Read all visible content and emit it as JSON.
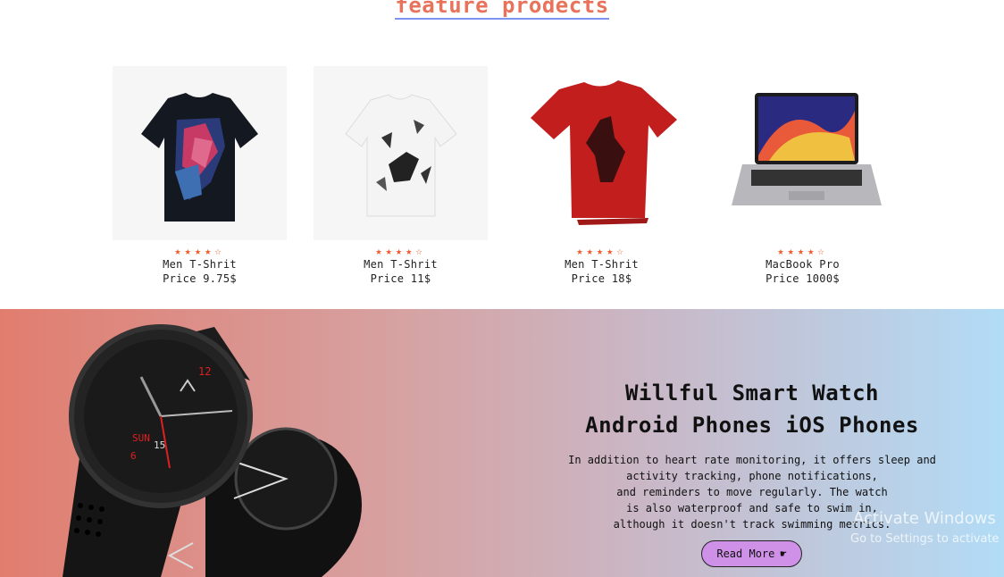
{
  "section": {
    "title": "feature prodects"
  },
  "products": [
    {
      "name": "Men T-Shrit",
      "price": "Price 9.75$",
      "rating": 4.5,
      "image": "dark-graphic-tshirt"
    },
    {
      "name": "Men T-Shrit",
      "price": "Price 11$",
      "rating": 4.5,
      "image": "white-splatter-tshirt"
    },
    {
      "name": "Men T-Shrit",
      "price": "Price 18$",
      "rating": 4.5,
      "image": "red-handprint-tshirt"
    },
    {
      "name": "MacBook Pro",
      "price": "Price 1000$",
      "rating": 4.5,
      "image": "laptop"
    }
  ],
  "banner": {
    "title_line1": "Willful Smart Watch",
    "title_line2": "Android Phones iOS Phones",
    "description_lines": [
      "In addition to heart rate monitoring, it offers sleep and",
      "activity tracking, phone notifications,",
      "and reminders to move regularly. The watch",
      "is also waterproof and safe to swim in,",
      "although it doesn't track swimming metrics."
    ],
    "button_label": "Read More",
    "button_icon": "hand-pointer-icon",
    "watch_labels": {
      "num12": "12",
      "day": "SUN",
      "date": "15",
      "num6": "6"
    }
  },
  "watermark": {
    "line1": "Activate Windows",
    "line2": "Go to Settings to activate"
  },
  "colors": {
    "title": "#e8735a",
    "underline": "#7f93f0",
    "stars": "#f05a2a",
    "button": "#cf90e8"
  }
}
